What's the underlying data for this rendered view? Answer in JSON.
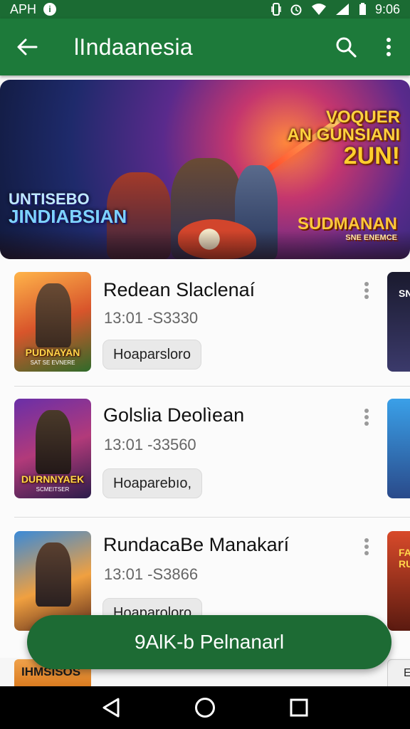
{
  "status_bar": {
    "carrier": "APH",
    "notification_icon": "info-circle-icon",
    "time": "9:06",
    "icons": [
      "vibrate-icon",
      "alarm-icon",
      "wifi-icon",
      "signal-icon",
      "battery-icon"
    ]
  },
  "app_bar": {
    "title": "lIndaanesia",
    "back_icon": "arrow-left-icon",
    "search_icon": "search-icon",
    "menu_icon": "more-vert-icon",
    "color": "#1d7a3a"
  },
  "banner": {
    "logo_left": [
      "UNTISEBO",
      "JINDIABSIAN"
    ],
    "logo_right": [
      "VOQUER",
      "AN GUNSIANI",
      "2UN!"
    ],
    "logo_bottom_right": [
      "SUDMANAN",
      "SNE ENEMCE"
    ]
  },
  "items": [
    {
      "name": "Redean Slaclenaí",
      "meta": "13:01 -S3330",
      "chip": "Hoaparsloro",
      "thumb_caption": "PUDNAYAN",
      "thumb_subcaption": "SAT SE EVNERE",
      "peek_label": "SN"
    },
    {
      "name": "Golslia Deolìean",
      "meta": "13:01 -33560",
      "chip": "Hoaparebıo,",
      "thumb_caption": "DURNNYAEK",
      "thumb_subcaption": "SCMEITSER",
      "peek_label": ""
    },
    {
      "name": "RundacaBe Manakarí",
      "meta": "13:01 -S3866",
      "chip": "Hoaparoloro",
      "thumb_caption": "",
      "thumb_subcaption": "",
      "peek_label": "FA RU"
    }
  ],
  "last_row": {
    "thumb_label": "IHMSISOS",
    "peek_label": "E"
  },
  "fab": {
    "label": "9AlK-b Pelnanarl"
  },
  "nav_bar": {
    "icons": [
      "back-triangle-icon",
      "home-circle-icon",
      "recents-square-icon"
    ]
  }
}
